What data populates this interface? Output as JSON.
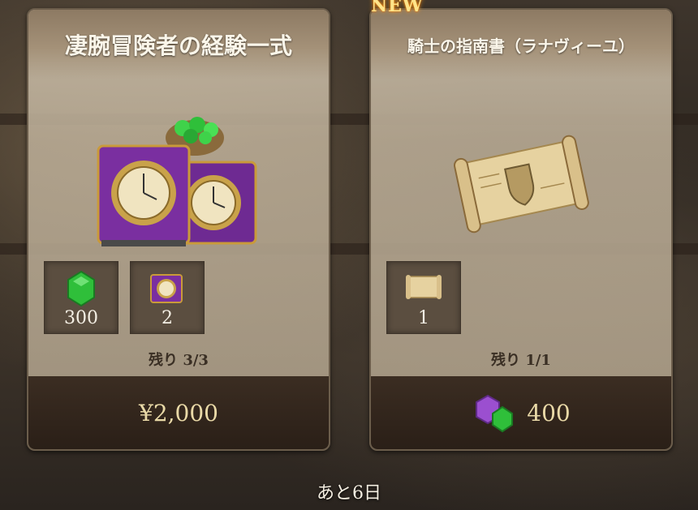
{
  "packs": [
    {
      "title": "凄腕冒険者の経験一式",
      "items": [
        {
          "icon": "green-gem-icon",
          "qty": "300"
        },
        {
          "icon": "exp-book-icon",
          "qty": "2"
        }
      ],
      "remaining": "残り 3/3",
      "price": "¥2,000"
    },
    {
      "badge": "NEW",
      "title": "騎士の指南書（ラナヴィーユ）",
      "items": [
        {
          "icon": "scroll-icon",
          "qty": "1"
        }
      ],
      "remaining": "残り 1/1",
      "price": "400",
      "price_icon": "gem-currency-icon"
    }
  ],
  "timer": "あと6日",
  "colors": {
    "gem_green": "#2fbf3a",
    "gem_purple": "#9b4fd0",
    "book_purple": "#7a2fa0",
    "gold": "#d8b14a"
  }
}
